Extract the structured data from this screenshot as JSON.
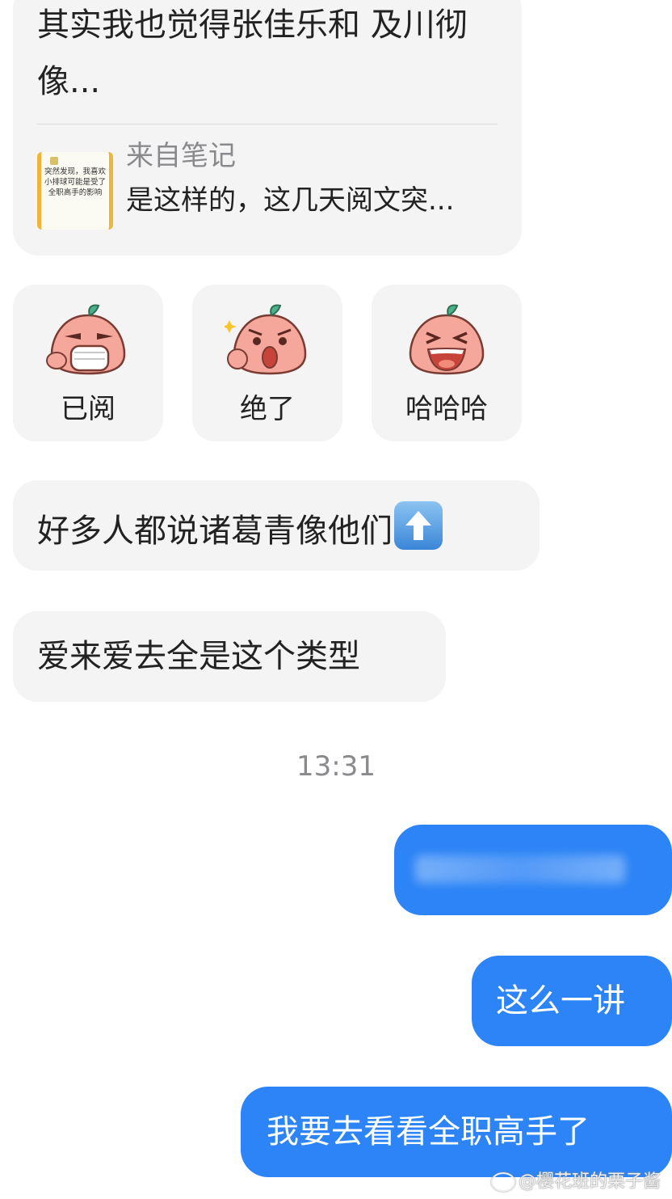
{
  "note_card": {
    "message_text": "其实我也觉得张佳乐和 及川彻像...",
    "thumbnail_text": "突然发现，我喜欢小排球可能是受了全职高手的影响",
    "source_label": "来自笔记",
    "preview_text": "是这样的，这几天阅文突..."
  },
  "stickers": [
    {
      "label": "已阅",
      "icon": "mask-peach-sticker-icon"
    },
    {
      "label": "绝了",
      "icon": "amazed-peach-sticker-icon"
    },
    {
      "label": "哈哈哈",
      "icon": "laughing-peach-sticker-icon"
    }
  ],
  "incoming": [
    {
      "text": "好多人都说诸葛青像他们",
      "emoji": "up-arrow-emoji"
    },
    {
      "text": "爱来爱去全是这个类型"
    }
  ],
  "timestamp": "13:31",
  "outgoing": [
    {
      "text": "",
      "note": "blurred-content"
    },
    {
      "text": "这么一讲"
    },
    {
      "text": "我要去看看全职高手了"
    }
  ],
  "watermark": "@樱花班的栗子酱",
  "colors": {
    "incoming_bubble": "#f4f4f5",
    "outgoing_bubble": "#2d84f6",
    "timestamp": "#8a8a8e"
  }
}
